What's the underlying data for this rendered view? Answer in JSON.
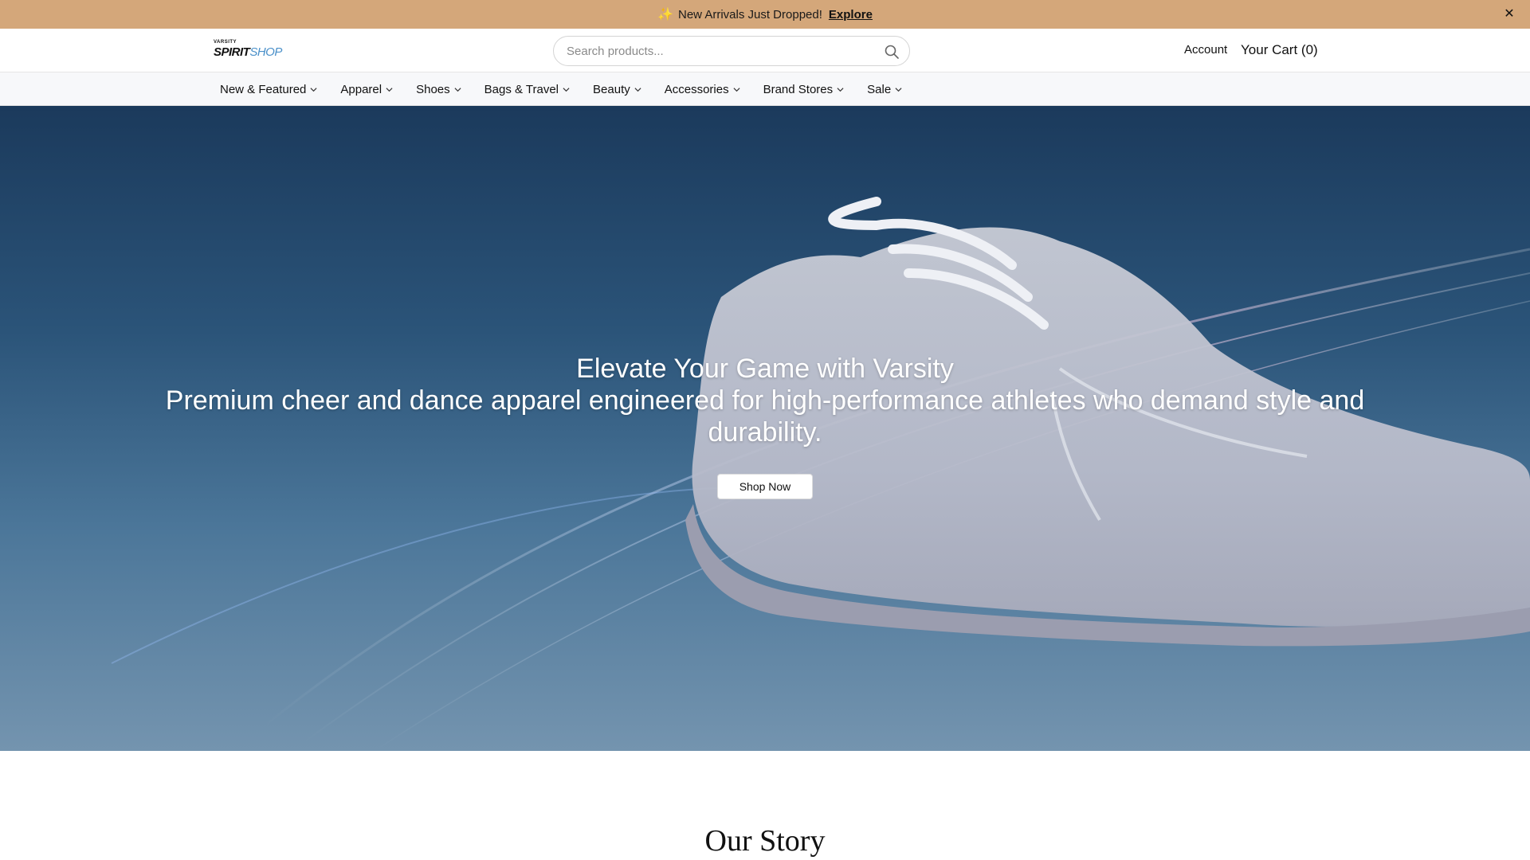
{
  "announcement": {
    "icon": "sparkle-icon",
    "text": "New Arrivals Just Dropped!",
    "link_label": "Explore",
    "close_icon": "close-icon"
  },
  "header": {
    "logo": {
      "top_text": "VARSITY",
      "word_main": "SPIRIT",
      "word_accent": "SHOP"
    },
    "search": {
      "placeholder": "Search products...",
      "value": "",
      "icon": "search-icon"
    },
    "account_label": "Account",
    "cart_label": "Your Cart (0)"
  },
  "nav": {
    "items": [
      {
        "label": "New & Featured"
      },
      {
        "label": "Apparel"
      },
      {
        "label": "Shoes"
      },
      {
        "label": "Bags & Travel"
      },
      {
        "label": "Beauty"
      },
      {
        "label": "Accessories"
      },
      {
        "label": "Brand Stores"
      },
      {
        "label": "Sale"
      }
    ],
    "item_icon": "chevron-down-icon"
  },
  "hero": {
    "title": "Elevate Your Game with Varsity",
    "subtitle": "Premium cheer and dance apparel engineered for high-performance athletes who demand style and durability.",
    "cta_label": "Shop Now",
    "image": "cheer-shoe-image"
  },
  "story": {
    "title": "Our Story"
  },
  "colors": {
    "announcement_bg": "#d4a77a",
    "hero_top": "#1b3a5c",
    "hero_bottom": "#7494af",
    "accent_blue": "#4a90c9"
  }
}
